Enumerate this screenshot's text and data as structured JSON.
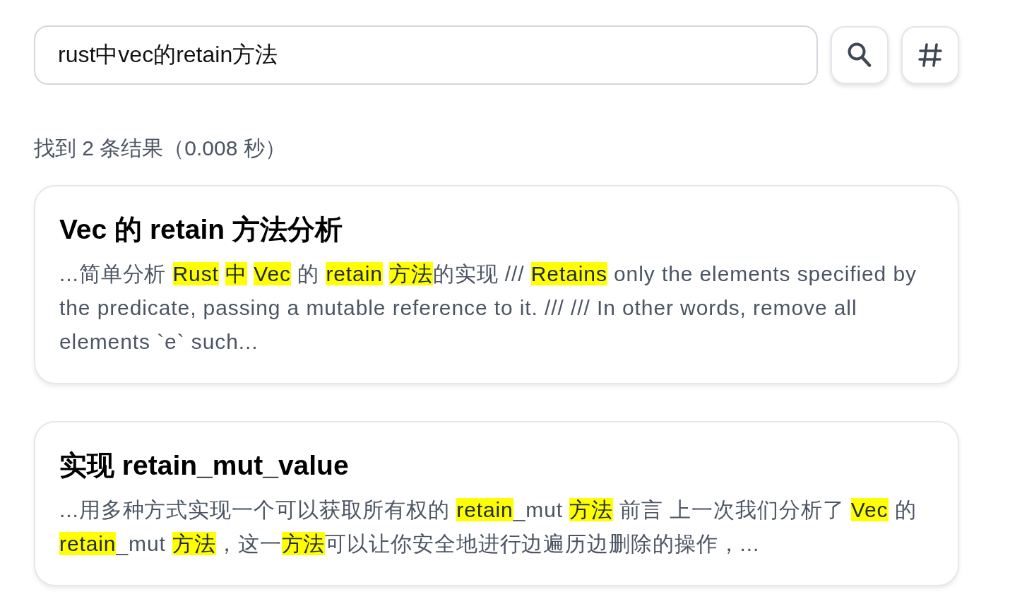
{
  "search": {
    "value": "rust中vec的retain方法"
  },
  "summary": "找到 2 条结果（0.008 秒）",
  "results": [
    {
      "title": "Vec 的 retain 方法分析",
      "snippet": [
        {
          "text": "...简单分析 ",
          "highlighted": false
        },
        {
          "text": "Rust",
          "highlighted": true,
          "space_after": true
        },
        {
          "text": "中",
          "highlighted": true,
          "space_after": true
        },
        {
          "text": "Vec",
          "highlighted": true,
          "space_after": false
        },
        {
          "text": " 的 ",
          "highlighted": false
        },
        {
          "text": "retain",
          "highlighted": true,
          "space_after": true
        },
        {
          "text": "方法",
          "highlighted": true,
          "space_after": false
        },
        {
          "text": "的实现 /// ",
          "highlighted": false
        },
        {
          "text": "Retains",
          "highlighted": true,
          "space_after": false
        },
        {
          "text": " only the elements specified by the predicate, passing a mutable reference to it. /// /// In other words, remove all elements `e` such...",
          "highlighted": false
        }
      ]
    },
    {
      "title": "实现 retain_mut_value",
      "snippet": [
        {
          "text": "...用多种方式实现一个可以获取所有权的 ",
          "highlighted": false
        },
        {
          "text": "retain",
          "highlighted": true,
          "space_after": false
        },
        {
          "text": "_mut ",
          "highlighted": false
        },
        {
          "text": "方法",
          "highlighted": true,
          "space_after": false
        },
        {
          "text": " 前言 上一次我们分析了 ",
          "highlighted": false
        },
        {
          "text": "Vec",
          "highlighted": true,
          "space_after": false
        },
        {
          "text": " 的 ",
          "highlighted": false
        },
        {
          "text": "retain",
          "highlighted": true,
          "space_after": false
        },
        {
          "text": "_mut ",
          "highlighted": false
        },
        {
          "text": "方法",
          "highlighted": true,
          "space_after": false
        },
        {
          "text": "，这一",
          "highlighted": false
        },
        {
          "text": "方法",
          "highlighted": true,
          "space_after": false
        },
        {
          "text": "可以让你安全地进行边遍历边删除的操作，...",
          "highlighted": false
        }
      ]
    }
  ]
}
